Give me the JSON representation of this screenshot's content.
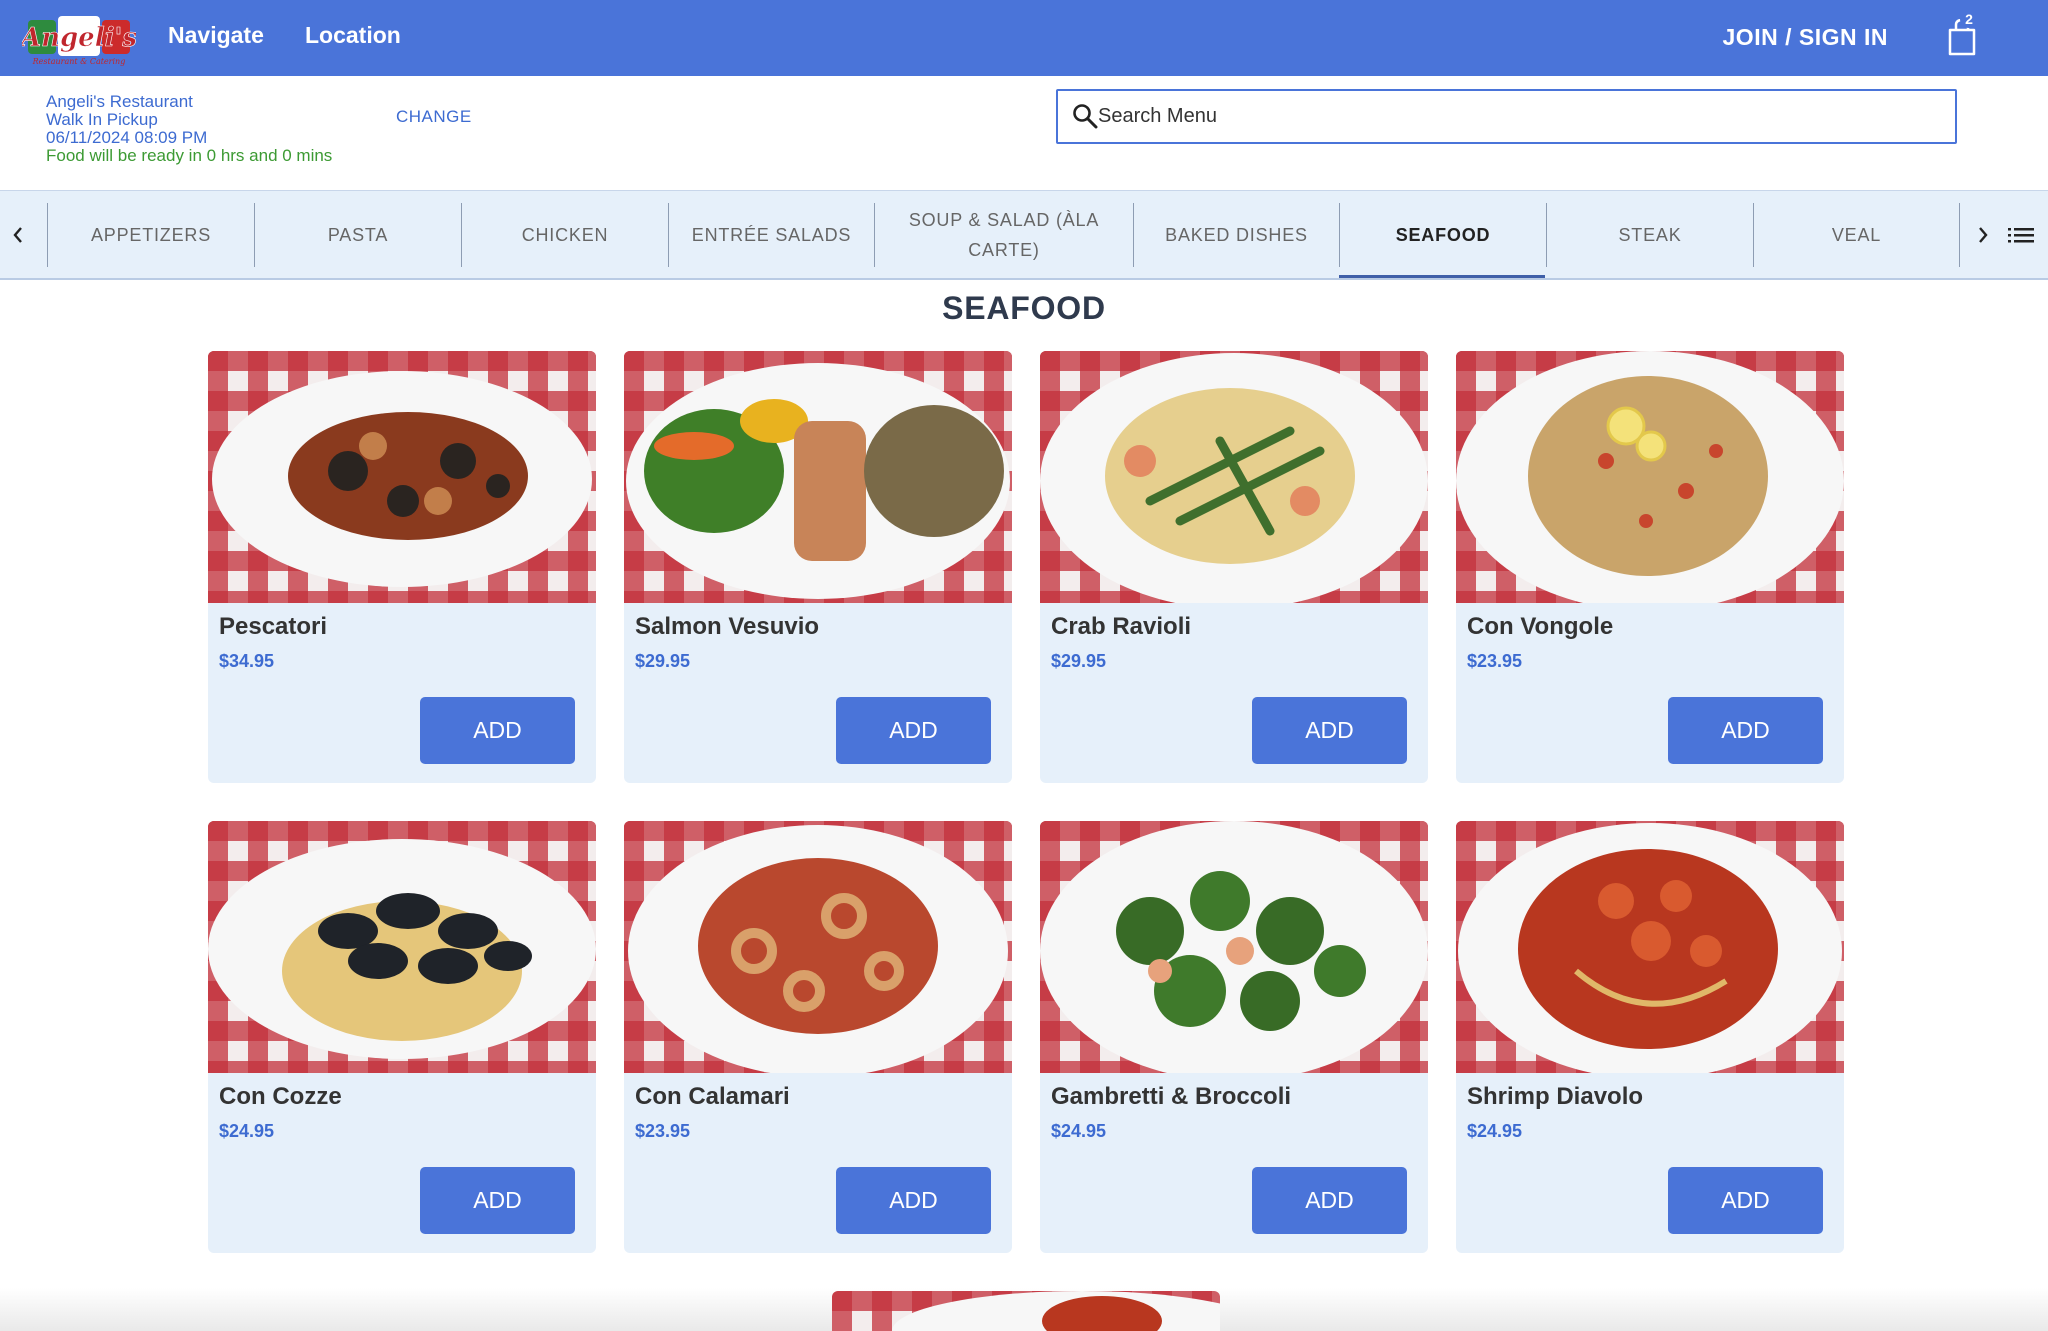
{
  "header": {
    "logo_text": "Angeli's",
    "logo_subtext": "Restaurant & Catering",
    "nav": [
      "Navigate",
      "Location"
    ],
    "join_label": "JOIN / SIGN IN",
    "cart_count": "2",
    "brand_color": "#4a74d9"
  },
  "order_info": {
    "restaurant": "Angeli's Restaurant",
    "mode": "Walk In Pickup",
    "datetime": "06/11/2024 08:09 PM",
    "ready": "Food will be ready in 0 hrs and 0 mins",
    "change_label": "CHANGE"
  },
  "search": {
    "placeholder": "Search Menu",
    "icon": "search-icon"
  },
  "tabs": {
    "items": [
      {
        "label": "APPETIZERS",
        "active": false
      },
      {
        "label": "PASTA",
        "active": false
      },
      {
        "label": "CHICKEN",
        "active": false
      },
      {
        "label": "ENTRÉE SALADS",
        "active": false
      },
      {
        "label": "SOUP & SALAD (ÀLA CARTE)",
        "active": false
      },
      {
        "label": "BAKED DISHES",
        "active": false
      },
      {
        "label": "SEAFOOD",
        "active": true
      },
      {
        "label": "STEAK",
        "active": false
      },
      {
        "label": "VEAL",
        "active": false
      }
    ]
  },
  "section": {
    "title": "SEAFOOD"
  },
  "menu_items": [
    {
      "name": "Pescatori",
      "price": "$34.95",
      "add_label": "ADD"
    },
    {
      "name": "Salmon Vesuvio",
      "price": "$29.95",
      "add_label": "ADD"
    },
    {
      "name": "Crab Ravioli",
      "price": "$29.95",
      "add_label": "ADD"
    },
    {
      "name": "Con Vongole",
      "price": "$23.95",
      "add_label": "ADD"
    },
    {
      "name": "Con Cozze",
      "price": "$24.95",
      "add_label": "ADD"
    },
    {
      "name": "Con Calamari",
      "price": "$23.95",
      "add_label": "ADD"
    },
    {
      "name": "Gambretti & Broccoli",
      "price": "$24.95",
      "add_label": "ADD"
    },
    {
      "name": "Shrimp Diavolo",
      "price": "$24.95",
      "add_label": "ADD"
    }
  ]
}
